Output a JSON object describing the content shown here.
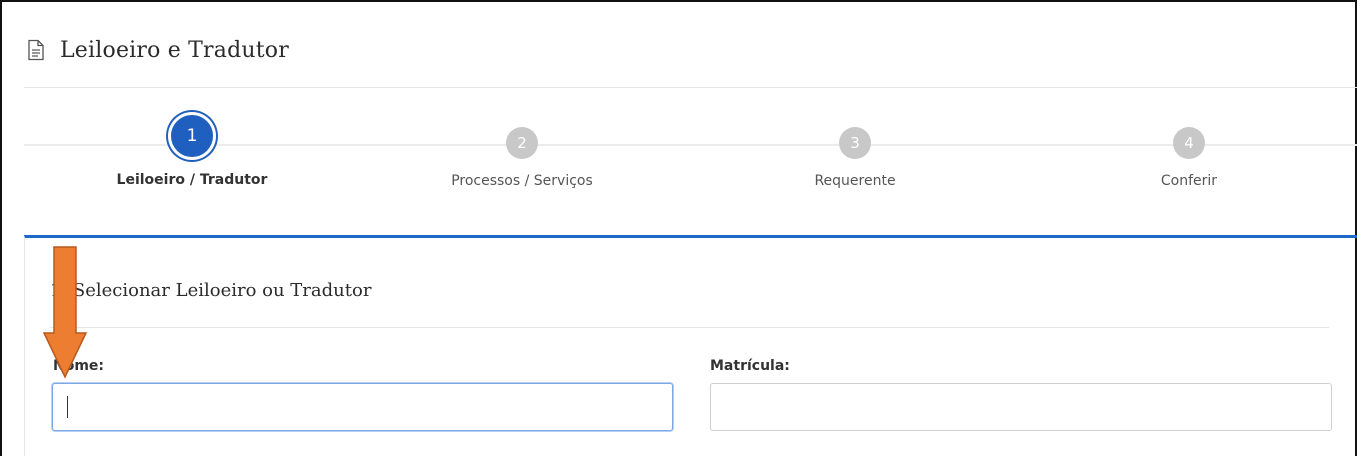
{
  "header": {
    "icon": "document-icon",
    "title": "Leiloeiro e Tradutor"
  },
  "stepper": {
    "steps": [
      {
        "number": "1",
        "label": "Leiloeiro / Tradutor",
        "state": "active"
      },
      {
        "number": "2",
        "label": "Processos / Serviços",
        "state": "inactive"
      },
      {
        "number": "3",
        "label": "Requerente",
        "state": "inactive"
      },
      {
        "number": "4",
        "label": "Conferir",
        "state": "inactive"
      }
    ]
  },
  "section": {
    "title": "1. Selecionar Leiloeiro ou Tradutor"
  },
  "form": {
    "nome_label": "Nome:",
    "nome_value": "",
    "matricula_label": "Matrícula:",
    "matricula_value": ""
  },
  "colors": {
    "accent": "#1f5fbf",
    "panel_border": "#1f69c6",
    "inactive_step": "#c8c8c8",
    "annotation_arrow": "#ed7d31"
  },
  "annotation": {
    "icon": "down-arrow-icon"
  }
}
